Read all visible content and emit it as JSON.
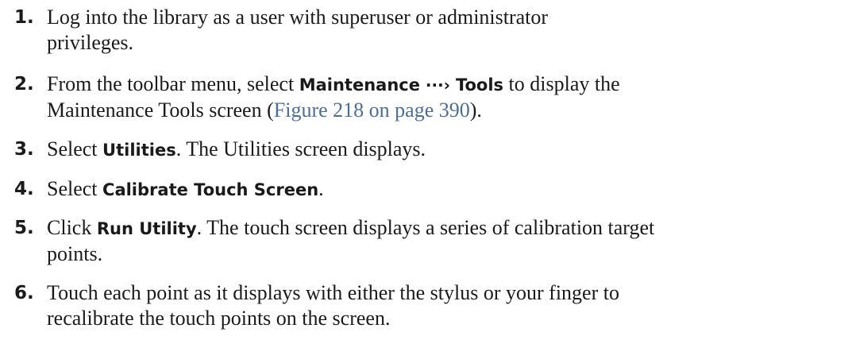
{
  "steps": [
    {
      "num": "1.",
      "t1": "Log into the library as a user with superuser or administrator",
      "t2": "privileges."
    },
    {
      "num": "2.",
      "t1": "From the toolbar menu, select ",
      "b1": "Maintenance",
      "arrow": " ···› ",
      "b2": "Tools",
      "t2": " to display the",
      "t3": "Maintenance Tools screen (",
      "link": "Figure 218 on page 390",
      "t4": ")."
    },
    {
      "num": "3.",
      "t1": "Select ",
      "b1": "Utilities",
      "t2": ". The Utilities screen displays."
    },
    {
      "num": "4.",
      "t1": "Select ",
      "b1": "Calibrate Touch Screen",
      "t2": "."
    },
    {
      "num": "5.",
      "t1": "Click ",
      "b1": "Run Utility",
      "t2": ". The touch screen displays a series of calibration target",
      "t3": "points."
    },
    {
      "num": "6.",
      "t1": "Touch each point as it displays with either the stylus or your finger to",
      "t2": "recalibrate the touch points on the screen."
    }
  ]
}
